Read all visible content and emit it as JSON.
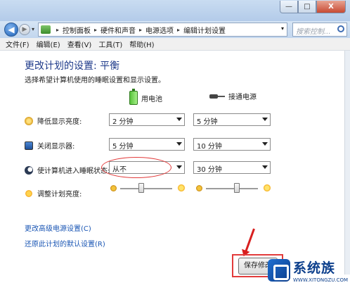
{
  "window": {
    "minimize": "—",
    "maximize": "□",
    "close": "X"
  },
  "address": {
    "crumbs": [
      "控制面板",
      "硬件和声音",
      "电源选项",
      "编辑计划设置"
    ],
    "search_placeholder": "搜索控制..."
  },
  "menu": [
    "文件(F)",
    "编辑(E)",
    "查看(V)",
    "工具(T)",
    "帮助(H)"
  ],
  "page": {
    "title": "更改计划的设置: 平衡",
    "subtitle": "选择希望计算机使用的睡眠设置和显示设置。",
    "col_battery": "用电池",
    "col_plugged": "接通电源"
  },
  "settings": [
    {
      "label": "降低显示亮度:",
      "icon": "dim-display-icon",
      "battery": "2 分钟",
      "plugged": "5 分钟"
    },
    {
      "label": "关闭显示器:",
      "icon": "monitor-icon",
      "battery": "5 分钟",
      "plugged": "10 分钟"
    },
    {
      "label": "使计算机进入睡眠状态:",
      "icon": "sleep-moon-icon",
      "battery": "从不",
      "plugged": "30 分钟"
    }
  ],
  "brightness": {
    "label": "调整计划亮度:",
    "battery_level": 0.4,
    "plugged_level": 0.6
  },
  "links": {
    "advanced": "更改高级电源设置(C)",
    "restore": "还原此计划的默认设置(R)"
  },
  "save_button": "保存修改",
  "watermark": {
    "brand": "系统族",
    "url": "WWW.XITONGZU.COM"
  },
  "colors": {
    "heading": "#1e3a8a",
    "link": "#1a56b4",
    "highlight": "#e23b3b"
  }
}
